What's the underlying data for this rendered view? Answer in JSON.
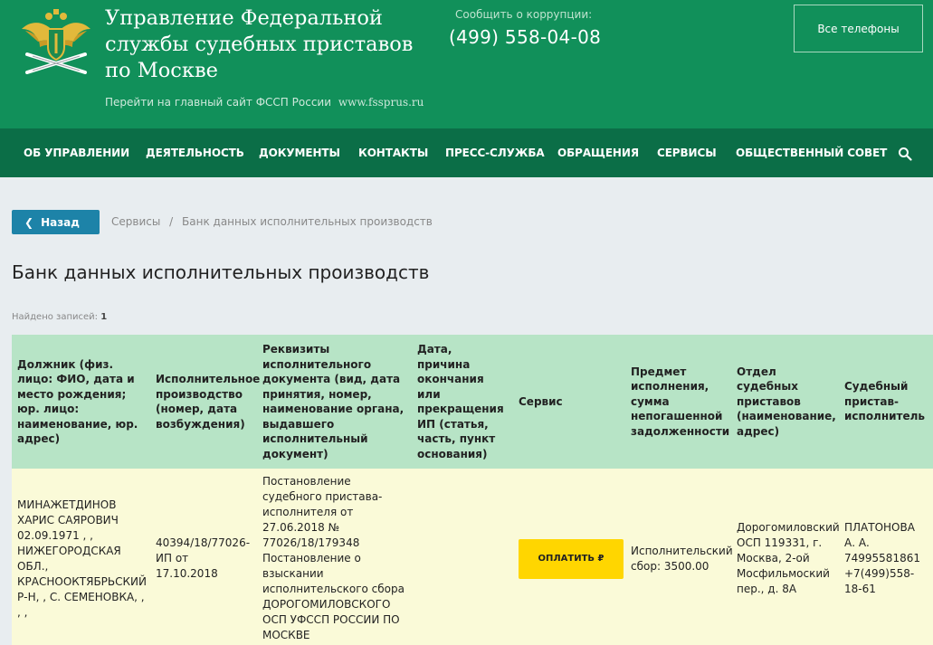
{
  "header": {
    "org_title": "Управление Федеральной службы судебных приставов по Москве",
    "main_site_text": "Перейти на главный сайт ФССП России",
    "main_site_link": "www.fssprus.ru",
    "corruption_label": "Сообщить о коррупции:",
    "corruption_phone": "(499) 558-04-08",
    "all_phones_label": "Все телефоны",
    "colors": {
      "header_bg": "#11905a",
      "nav_bg": "#0b6e47"
    }
  },
  "nav": {
    "items": [
      "ОБ УПРАВЛЕНИИ",
      "ДЕЯТЕЛЬНОСТЬ",
      "ДОКУМЕНТЫ",
      "КОНТАКТЫ",
      "ПРЕСС-СЛУЖБА",
      "ОБРАЩЕНИЯ",
      "СЕРВИСЫ",
      "ОБЩЕСТВЕННЫЙ СОВЕТ"
    ],
    "search_icon": "search-icon"
  },
  "back_button": {
    "label": "Назад"
  },
  "breadcrumb": {
    "items": [
      "Сервисы",
      "Банк данных исполнительных производств"
    ],
    "separator": "/"
  },
  "page_title": "Банк данных исполнительных производств",
  "found": {
    "label": "Найдено записей:",
    "count": "1"
  },
  "table": {
    "headers": [
      "Должник (физ. лицо: ФИО, дата и место рождения; юр. лицо: наименование, юр. адрес)",
      "Исполнительное производство (номер, дата возбуждения)",
      "Реквизиты исполнительного документа (вид, дата принятия, номер, наименование органа, выдавшего исполнительный документ)",
      "Дата, причина окончания или прекращения ИП (статья, часть, пункт основания)",
      "Сервис",
      "Предмет исполнения, сумма непогашенной задолженности",
      "Отдел судебных приставов (наименование, адрес)",
      "Судебный пристав-исполнитель"
    ],
    "rows": [
      {
        "debtor": "МИНАЖЕТДИНОВ ХАРИС САЯРОВИЧ 02.09.1971 , , НИЖЕГОРОДСКАЯ ОБЛ., КРАСНООКТЯБРЬСКИЙ Р-Н, , С. СЕМЕНОВКА, , , ,",
        "proceeding": "40394/18/77026-ИП от 17.10.2018",
        "document": "Постановление судебного пристава-исполнителя от 27.06.2018 № 77026/18/179348 Постановление о взыскании исполнительского сбора ДОРОГОМИЛОВСКОГО ОСП УФССП РОССИИ ПО МОСКВЕ",
        "end_reason": "",
        "pay_button": "ОПЛАТИТЬ ₽",
        "subject": "Исполнительский сбор: 3500.00",
        "department": "Дорогомиловский ОСП 119331, г. Москва, 2-ой Мосфильмоский пер., д. 8А",
        "bailiff": "ПЛАТОНОВА А. А. 74995581861 +7(499)558-18-61"
      }
    ],
    "colors": {
      "header_bg": "#b7e4c6",
      "row_bg": "#fafad8",
      "pay_bg": "#ffd600"
    }
  }
}
